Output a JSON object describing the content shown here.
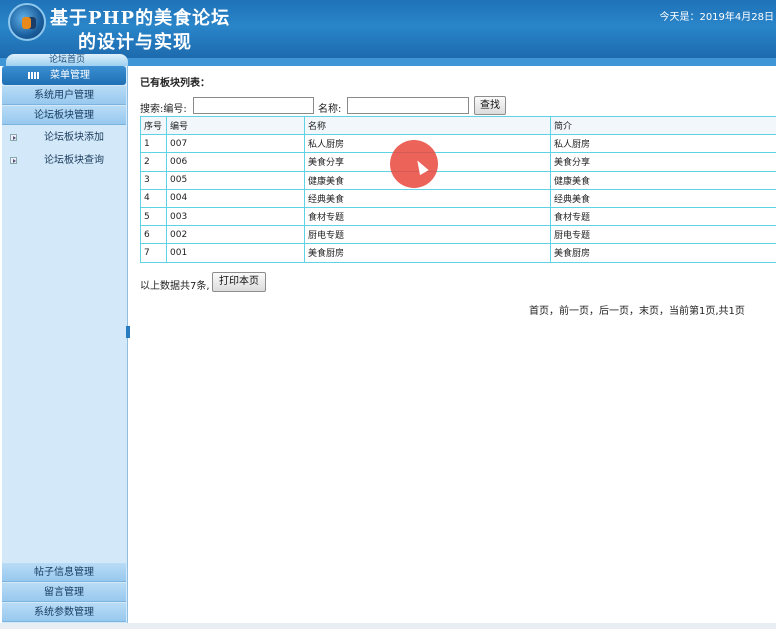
{
  "header": {
    "title_line1": "基于PHP的美食论坛",
    "title_line2": "的设计与实现",
    "date_text": "今天是：2019年4月28日",
    "home_tab": "论坛首页"
  },
  "sidebar": {
    "menu_head": "菜单管理",
    "sections_top": [
      "系统用户管理",
      "论坛板块管理"
    ],
    "sub_items": [
      "论坛板块添加",
      "论坛板块查询"
    ],
    "sections_bottom": [
      "帖子信息管理",
      "留言管理",
      "系统参数管理"
    ]
  },
  "main": {
    "list_title": "已有板块列表：",
    "search": {
      "label_search": "搜索:编号:",
      "label_name": "名称:",
      "code_value": "",
      "name_value": "",
      "button": "查找"
    },
    "table": {
      "headers": [
        "序号",
        "编号",
        "名称",
        "简介"
      ],
      "rows": [
        [
          "1",
          "007",
          "私人厨房",
          "私人厨房"
        ],
        [
          "2",
          "006",
          "美食分享",
          "美食分享"
        ],
        [
          "3",
          "005",
          "健康美食",
          "健康美食"
        ],
        [
          "4",
          "004",
          "经典美食",
          "经典美食"
        ],
        [
          "5",
          "003",
          "食材专题",
          "食材专题"
        ],
        [
          "6",
          "002",
          "厨电专题",
          "厨电专题"
        ],
        [
          "7",
          "001",
          "美食厨房",
          "美食厨房"
        ]
      ]
    },
    "count_text": "以上数据共7条,",
    "print_button": "打印本页",
    "pager_text": "首页，前一页，后一页，末页，当前第1页,共1页"
  },
  "colors": {
    "header_blue": "#2a85c9",
    "sidebar_bg": "#d3e9f9",
    "table_border": "#5fd3e3",
    "cursor_highlight": "#e8483c"
  }
}
